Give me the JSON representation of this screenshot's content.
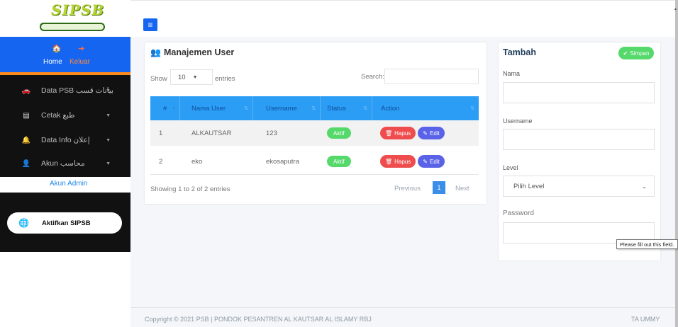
{
  "brand": {
    "logo_text": "SIPSB"
  },
  "user_panel": {
    "home_label": "Home",
    "logout_label": "Keluar"
  },
  "sidebar": {
    "items": [
      {
        "label": "Data PSB بيانات قسب",
        "icon": "car-icon"
      },
      {
        "label": "Cetak طبع",
        "icon": "printer-icon"
      },
      {
        "label": "Data Info إعلان",
        "icon": "bell-icon"
      },
      {
        "label": "Akun محاسب",
        "icon": "user-icon"
      }
    ],
    "active_sub": "Akun Admin",
    "activate_button": "Aktifkan SIPSB"
  },
  "table_panel": {
    "title": "Manajemen User",
    "show_label": "Show",
    "page_size": "10",
    "entries_label": "entries",
    "search_label": "Search:",
    "columns": [
      "#",
      "Nama User",
      "Username",
      "Status",
      "Action"
    ],
    "rows": [
      {
        "no": "1",
        "nama": "ALKAUTSAR",
        "username": "123",
        "status": "Aktif",
        "hapus": "Hapus",
        "edit": "Edit"
      },
      {
        "no": "2",
        "nama": "eko",
        "username": "ekosaputra",
        "status": "Aktif",
        "hapus": "Hapus",
        "edit": "Edit"
      }
    ],
    "info": "Showing 1 to 2 of 2 entries",
    "pagination": {
      "prev": "Previous",
      "current": "1",
      "next": "Next"
    }
  },
  "form_panel": {
    "title": "Tambah",
    "save_button": "Simpan",
    "nama_label": "Nama",
    "username_label": "Username",
    "level_label": "Level",
    "level_selected": "Pilih Level",
    "password_label": "Password",
    "tooltip": "Please fill out this field."
  },
  "footer": {
    "copyright": "Copyright © 2021 PSB | PONDOK PESANTREN AL KAUTSAR AL ISLAMY RBJ",
    "right_text": "TA UMMY"
  },
  "colors": {
    "primary": "#1565f0",
    "accent": "#ff8a1c",
    "table_header": "#2c9df5",
    "success": "#55d96b",
    "danger": "#ef4d4d",
    "edit": "#5a63e8"
  }
}
